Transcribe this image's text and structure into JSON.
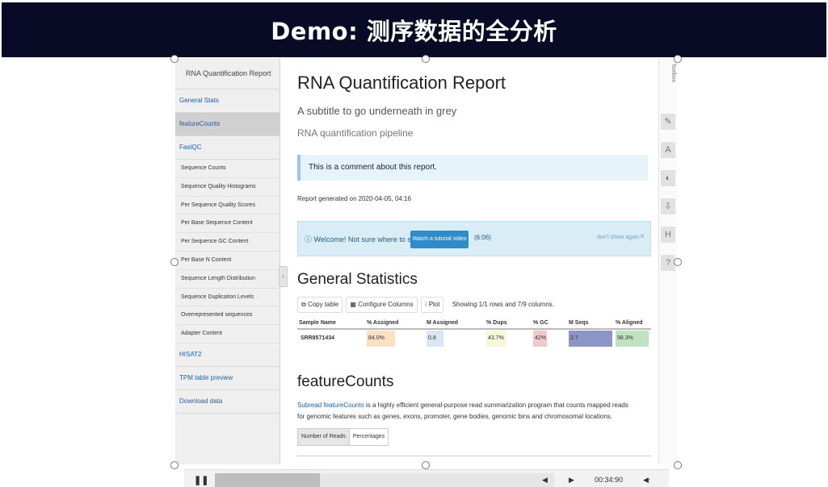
{
  "slide": {
    "title": "Demo: 测序数据的全分析"
  },
  "sidebar": {
    "title": "RNA Quantification Report",
    "sections": [
      {
        "label": "General Stats"
      },
      {
        "label": "featureCounts"
      },
      {
        "label": "FastQC"
      }
    ],
    "fastqc_items": [
      "Sequence Counts",
      "Sequence Quality Histograms",
      "Per Sequence Quality Scores",
      "Per Base Sequence Content",
      "Per Sequence GC Content",
      "Per Base N Content",
      "Sequence Length Distribution",
      "Sequence Duplication Levels",
      "Overrepresented sequences",
      "Adapter Content"
    ],
    "more_sections": [
      "HISAT2",
      "TPM table preview",
      "Download data"
    ]
  },
  "report": {
    "title": "RNA Quantification Report",
    "subtitle": "A subtitle to go underneath in grey",
    "pipeline": "RNA quantification pipeline",
    "comment": "This is a comment about this report.",
    "generated": "Report generated on 2020-04-05, 04:16",
    "welcome": {
      "text": "Welcome! Not sure where to start?",
      "button": "Watch a tutorial video",
      "hide": "(6:06)",
      "dont_show": "don't show again",
      "close": "×"
    }
  },
  "general_stats": {
    "title": "General Statistics",
    "toolbar": {
      "copy": "Copy table",
      "configure": "Configure Columns",
      "plot": "Plot",
      "showing": "Showing 1/1 rows and 7/9 columns."
    },
    "columns": [
      "Sample Name",
      "% Assigned",
      "M Assigned",
      "% Dups",
      "% GC",
      "M Seqs",
      "% Aligned"
    ],
    "rows": [
      {
        "sample": "SRR8571434",
        "assigned_pct": "84.0%",
        "m_assigned": "0.8",
        "dups": "43.7%",
        "gc": "42%",
        "m_seqs": "2.7",
        "aligned": "98.3%"
      }
    ],
    "cell_colors": {
      "assigned_pct": "#fbe0c1",
      "m_assigned": "#dbe6f4",
      "dups": "#f6f6d8",
      "gc": "#f0c9c9",
      "m_seqs": "#8c96c6",
      "aligned": "#bfe3c1"
    },
    "cell_fill": {
      "assigned_pct": 0.5,
      "m_assigned": 0.3,
      "dups": 0.45,
      "gc": 0.42,
      "m_seqs": 1.0,
      "aligned": 0.98
    }
  },
  "feature_counts": {
    "title": "featureCounts",
    "link": "Subread featureCounts",
    "desc": " is a highly efficient general-purpose read summarization program that counts mapped reads for genomic features such as genes, exons, promoter, gene bodies, genomic bins and chromosomal locations.",
    "tabs": [
      "Number of Reads",
      "Percentages"
    ]
  },
  "toolbox": {
    "label": "Toolbox",
    "icons": [
      "pin-icon",
      "text-icon",
      "eye-icon",
      "download-icon",
      "save-icon",
      "help-icon"
    ]
  },
  "player": {
    "time": "00:34:90",
    "play_icon": "pause-icon",
    "progress": 0.31
  }
}
